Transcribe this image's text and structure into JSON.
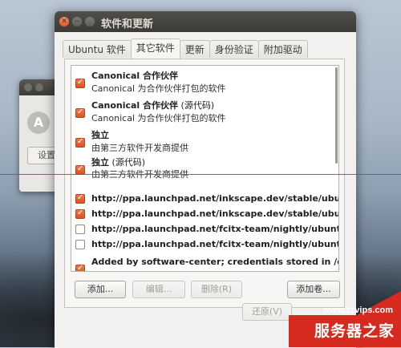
{
  "background_window": {
    "button_label": "设置"
  },
  "window": {
    "title": "软件和更新",
    "tabs": [
      {
        "label": "Ubuntu 软件"
      },
      {
        "label": "其它软件"
      },
      {
        "label": "更新"
      },
      {
        "label": "身份验证"
      },
      {
        "label": "附加驱动"
      }
    ],
    "sources": [
      {
        "checked": true,
        "title": "Canonical 合作伙伴",
        "title_suffix": "",
        "subtitle": "Canonical 为合作伙伴打包的软件"
      },
      {
        "checked": true,
        "title": "Canonical 合作伙伴",
        "title_suffix": " (源代码)",
        "subtitle": "Canonical 为合作伙伴打包的软件"
      },
      {
        "checked": true,
        "title": "独立",
        "title_suffix": "",
        "subtitle": "由第三方软件开发商提供"
      },
      {
        "checked": true,
        "title": "独立",
        "title_suffix": " (源代码)",
        "subtitle": "由第三方软件开发商提供"
      },
      {
        "checked": true,
        "url": "http://ppa.launchpad.net/inkscape.dev/stable/ubuntu"
      },
      {
        "checked": true,
        "url": "http://ppa.launchpad.net/inkscape.dev/stable/ubuntu"
      },
      {
        "checked": false,
        "url": "http://ppa.launchpad.net/fcitx-team/nightly/ubuntu tr"
      },
      {
        "checked": false,
        "url": "http://ppa.launchpad.net/fcitx-team/nightly/ubuntu tr"
      },
      {
        "checked": true,
        "url": "Added by software-center; credentials stored in /etc/a"
      }
    ],
    "buttons": {
      "add": "添加...",
      "edit": "编辑...",
      "remove": "删除(R)",
      "add_volume": "添加卷...",
      "revert": "还原(V)"
    }
  },
  "watermark": {
    "url": "www.zzvips.com",
    "brand": "服务器之家"
  },
  "colors": {
    "accent": "#dd5522",
    "watermark_red": "#d72a1f",
    "titlebar": "#3c3b37"
  }
}
